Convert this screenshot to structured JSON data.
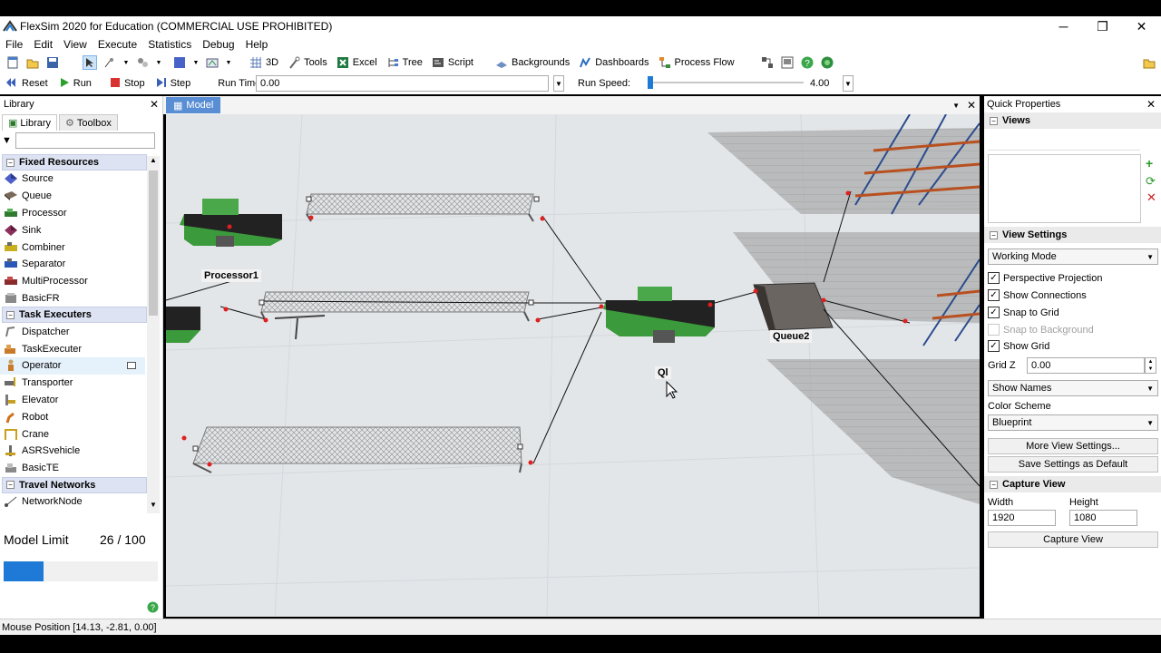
{
  "window": {
    "title": "FlexSim 2020 for Education (COMMERCIAL USE PROHIBITED)",
    "minimize": "─",
    "restore": "❐",
    "close": "✕"
  },
  "menu": [
    "File",
    "Edit",
    "View",
    "Execute",
    "Statistics",
    "Debug",
    "Help"
  ],
  "toolbar": {
    "btn_3d": "3D",
    "tools": "Tools",
    "excel": "Excel",
    "tree": "Tree",
    "script": "Script",
    "backgrounds": "Backgrounds",
    "dashboards": "Dashboards",
    "process_flow": "Process Flow"
  },
  "runbar": {
    "reset": "Reset",
    "run": "Run",
    "stop": "Stop",
    "step": "Step",
    "run_time_label": "Run Time:",
    "run_time_value": "0.00",
    "run_speed_label": "Run Speed:",
    "run_speed_value": "4.00"
  },
  "library": {
    "title": "Library",
    "tab_library": "Library",
    "tab_toolbox": "Toolbox",
    "categories": [
      {
        "label": "Fixed Resources",
        "items": [
          "Source",
          "Queue",
          "Processor",
          "Sink",
          "Combiner",
          "Separator",
          "MultiProcessor",
          "BasicFR"
        ]
      },
      {
        "label": "Task Executers",
        "items": [
          "Dispatcher",
          "TaskExecuter",
          "Operator",
          "Transporter",
          "Elevator",
          "Robot",
          "Crane",
          "ASRSvehicle",
          "BasicTE"
        ]
      },
      {
        "label": "Travel Networks",
        "items": [
          "NetworkNode"
        ]
      }
    ],
    "selected_item": "Operator",
    "model_limit_label": "Model Limit",
    "model_limit_value": "26 / 100",
    "model_limit_fraction": 0.26
  },
  "model": {
    "tab": "Model",
    "labels": {
      "processor1": "Processor1",
      "queue2": "Queue2",
      "ql": "Ql"
    }
  },
  "quick_properties": {
    "title": "Quick Properties",
    "views_section": "Views",
    "view_settings_section": "View Settings",
    "mode": "Working Mode",
    "checkboxes": [
      {
        "label": "Perspective Projection",
        "checked": true,
        "enabled": true
      },
      {
        "label": "Show Connections",
        "checked": true,
        "enabled": true
      },
      {
        "label": "Snap to Grid",
        "checked": true,
        "enabled": true
      },
      {
        "label": "Snap to Background",
        "checked": false,
        "enabled": false
      },
      {
        "label": "Show Grid",
        "checked": true,
        "enabled": true
      }
    ],
    "grid_z_label": "Grid Z",
    "grid_z_value": "0.00",
    "show_names": "Show Names",
    "color_scheme_label": "Color Scheme",
    "color_scheme": "Blueprint",
    "more_settings": "More View Settings...",
    "save_default": "Save Settings as Default",
    "capture_section": "Capture View",
    "width_label": "Width",
    "height_label": "Height",
    "width_value": "1920",
    "height_value": "1080",
    "capture_btn": "Capture View"
  },
  "status": {
    "mouse_position": "Mouse Position [14.13, -2.81, 0.00]"
  },
  "colors": {
    "accent": "#1e7ad6",
    "category_bg": "#dde3f3",
    "model_tab": "#5a8ed4",
    "viewport": "#e3e6e9"
  }
}
